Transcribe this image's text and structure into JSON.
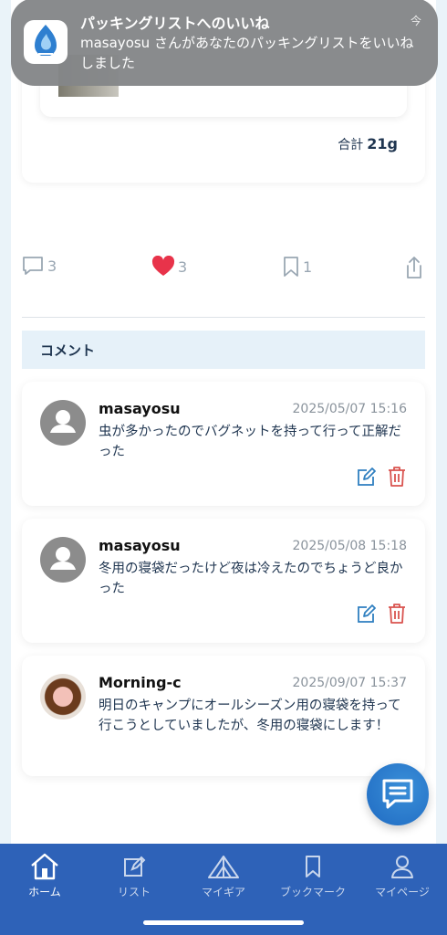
{
  "notification": {
    "title": "パッキングリストへのいいね",
    "body": "masayosu さんがあなたのパッキングリストをいいねしました",
    "time": "今"
  },
  "summary": {
    "total_label": "合計",
    "total_value": "21g"
  },
  "actions": {
    "comments_count": "3",
    "likes_count": "3",
    "bookmarks_count": "1"
  },
  "comments_section": {
    "title": "コメント",
    "items": [
      {
        "user": "masayosu",
        "time": "2025/05/07 15:16",
        "text": "虫が多かったのでバグネットを持って行って正解だった",
        "editable": true
      },
      {
        "user": "masayosu",
        "time": "2025/05/08 15:18",
        "text": "冬用の寝袋だったけど夜は冷えたのでちょうど良かった",
        "editable": true
      },
      {
        "user": "Morning-c",
        "time": "2025/09/07 15:37",
        "text": "明日のキャンプにオールシーズン用の寝袋を持って行こうとしていましたが、冬用の寝袋にします！",
        "editable": false
      }
    ]
  },
  "bottom_nav": {
    "items": [
      {
        "label": "ホーム",
        "icon": "home-icon",
        "active": true
      },
      {
        "label": "リスト",
        "icon": "edit-list-icon",
        "active": false
      },
      {
        "label": "マイギア",
        "icon": "tent-icon",
        "active": false
      },
      {
        "label": "ブックマーク",
        "icon": "bookmark-icon",
        "active": false
      },
      {
        "label": "マイページ",
        "icon": "person-icon",
        "active": false
      }
    ]
  },
  "colors": {
    "accent": "#2e62b8",
    "like": "#e8334a",
    "delete": "#d9534f",
    "edit": "#2f7fc0"
  }
}
